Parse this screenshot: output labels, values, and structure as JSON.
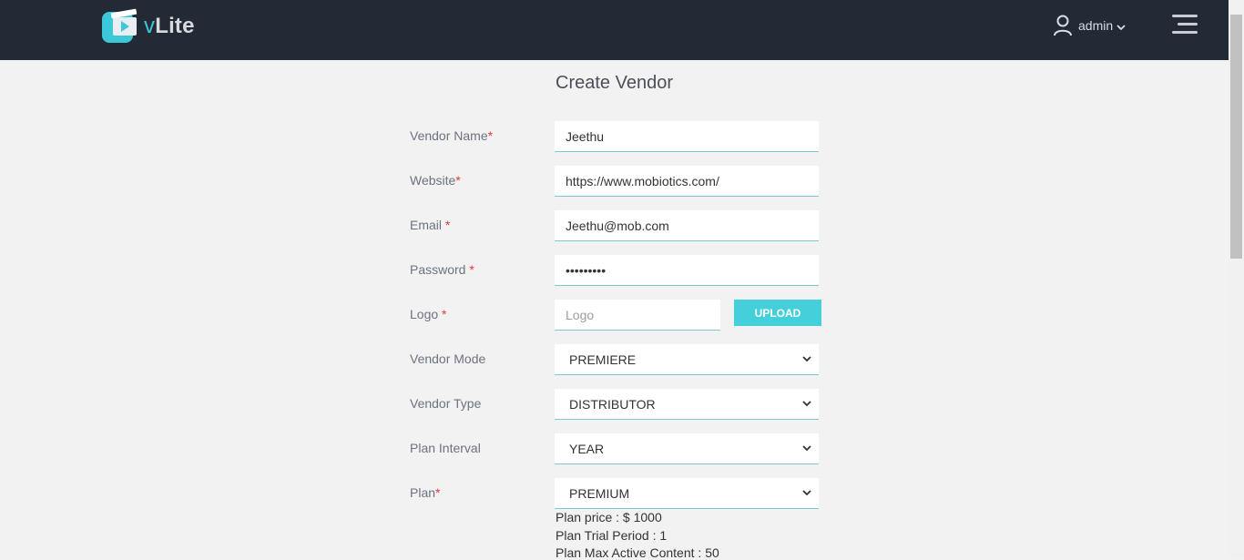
{
  "header": {
    "logo_prefix": "v",
    "logo_suffix": "Lite",
    "user_name": "admin",
    "colors": {
      "bar": "#222a35",
      "accent": "#3cc8d6"
    }
  },
  "page": {
    "title": "Create Vendor"
  },
  "form": {
    "vendor_name": {
      "label": "Vendor Name",
      "required": "*",
      "value": "Jeethu"
    },
    "website": {
      "label": "Website",
      "required": "*",
      "value": "https://www.mobiotics.com/"
    },
    "email": {
      "label": "Email ",
      "required": "*",
      "value": "Jeethu@mob.com"
    },
    "password": {
      "label": "Password ",
      "required": "*",
      "value": "•••••••••"
    },
    "logo": {
      "label": "Logo ",
      "required": "*",
      "placeholder": "Logo",
      "upload_label": "UPLOAD"
    },
    "vendor_mode": {
      "label": "Vendor Mode",
      "value": "PREMIERE"
    },
    "vendor_type": {
      "label": "Vendor Type",
      "value": "DISTRIBUTOR"
    },
    "plan_interval": {
      "label": "Plan Interval",
      "value": "YEAR"
    },
    "plan": {
      "label": "Plan",
      "required": "*",
      "value": "PREMIUM"
    }
  },
  "plan_info": {
    "price": "Plan price : $ 1000",
    "trial": "Plan Trial Period : 1",
    "max_content": "Plan Max Active Content : 50"
  }
}
